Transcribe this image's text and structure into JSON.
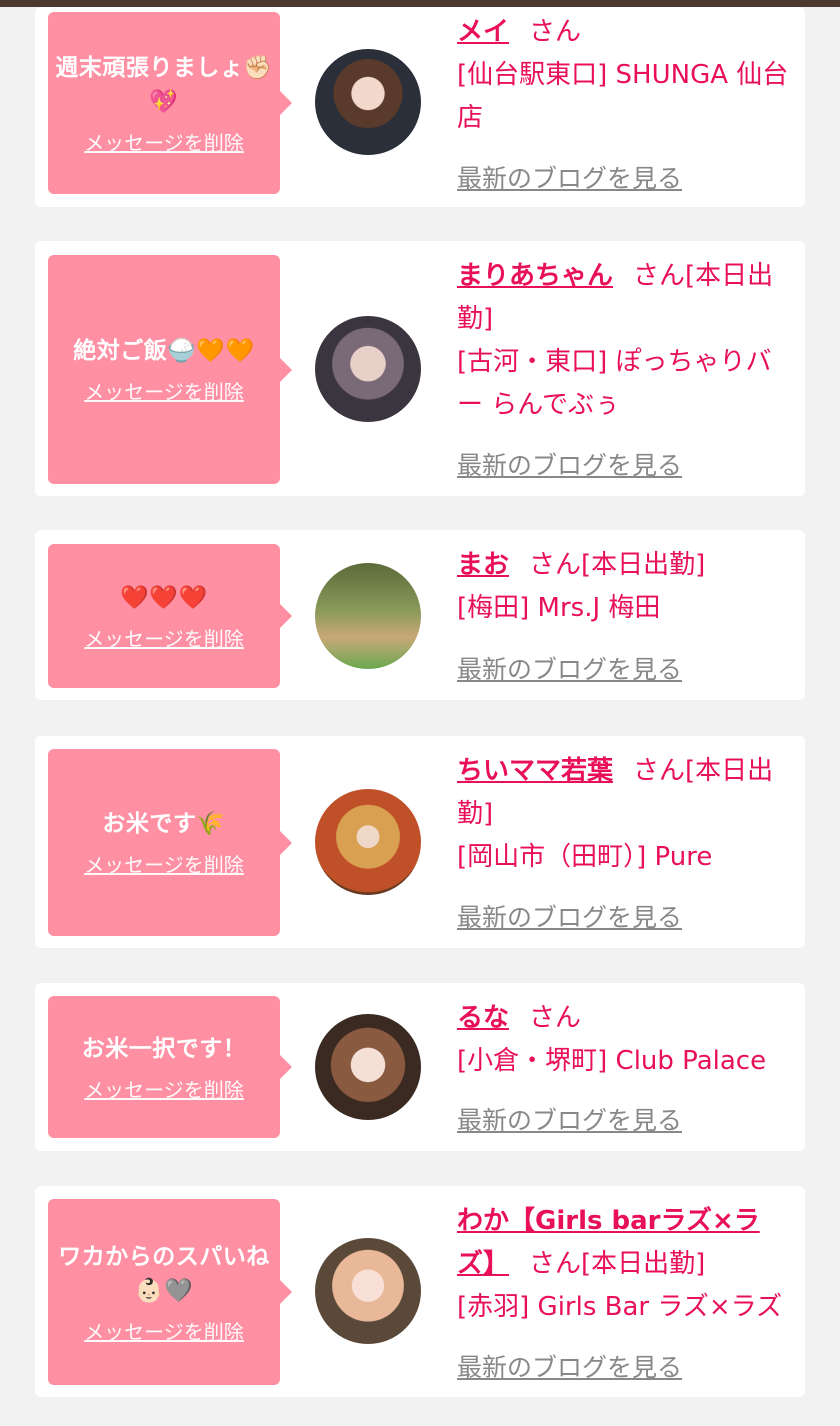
{
  "cards": [
    {
      "message": "週末頑張りましょ✊🏻💖",
      "delete": "メッセージを削除",
      "name": "メイ",
      "san": "さん",
      "status": "",
      "shop": "[仙台駅東口] SHUNGA 仙台店",
      "blog": "最新のブログを見る"
    },
    {
      "message": "絶対ご飯🍚🧡🧡",
      "delete": "メッセージを削除",
      "name": "まりあちゃん",
      "san": "さん",
      "status": "[本日出勤]",
      "shop": "[古河・東口] ぽっちゃりバー らんでぶぅ",
      "blog": "最新のブログを見る"
    },
    {
      "message": "❤️❤️❤️",
      "delete": "メッセージを削除",
      "name": "まお",
      "san": "さん",
      "status": "[本日出勤]",
      "shop": "[梅田] Mrs.J 梅田",
      "blog": "最新のブログを見る"
    },
    {
      "message": "お米です🌾",
      "delete": "メッセージを削除",
      "name": "ちいママ若葉",
      "san": "さん",
      "status": "[本日出勤]",
      "shop": "[岡山市（田町）] Pure",
      "blog": "最新のブログを見る"
    },
    {
      "message": "お米一択です！",
      "delete": "メッセージを削除",
      "name": "るな",
      "san": "さん",
      "status": "",
      "shop": "[小倉・堺町] Club Palace",
      "blog": "最新のブログを見る"
    },
    {
      "message": "ワカからのスパいね👶🏻🩶",
      "delete": "メッセージを削除",
      "name": "わか【Girls barラズ×ラズ】",
      "san": "さん",
      "status": "[本日出勤]",
      "shop": "[赤羽] Girls Bar ラズ×ラズ",
      "blog": "最新のブログを見る"
    }
  ],
  "colors": {
    "accent": "#e8105a",
    "bubble": "#ff8fa3",
    "link_gray": "#888888",
    "background": "#f2f2f2"
  }
}
